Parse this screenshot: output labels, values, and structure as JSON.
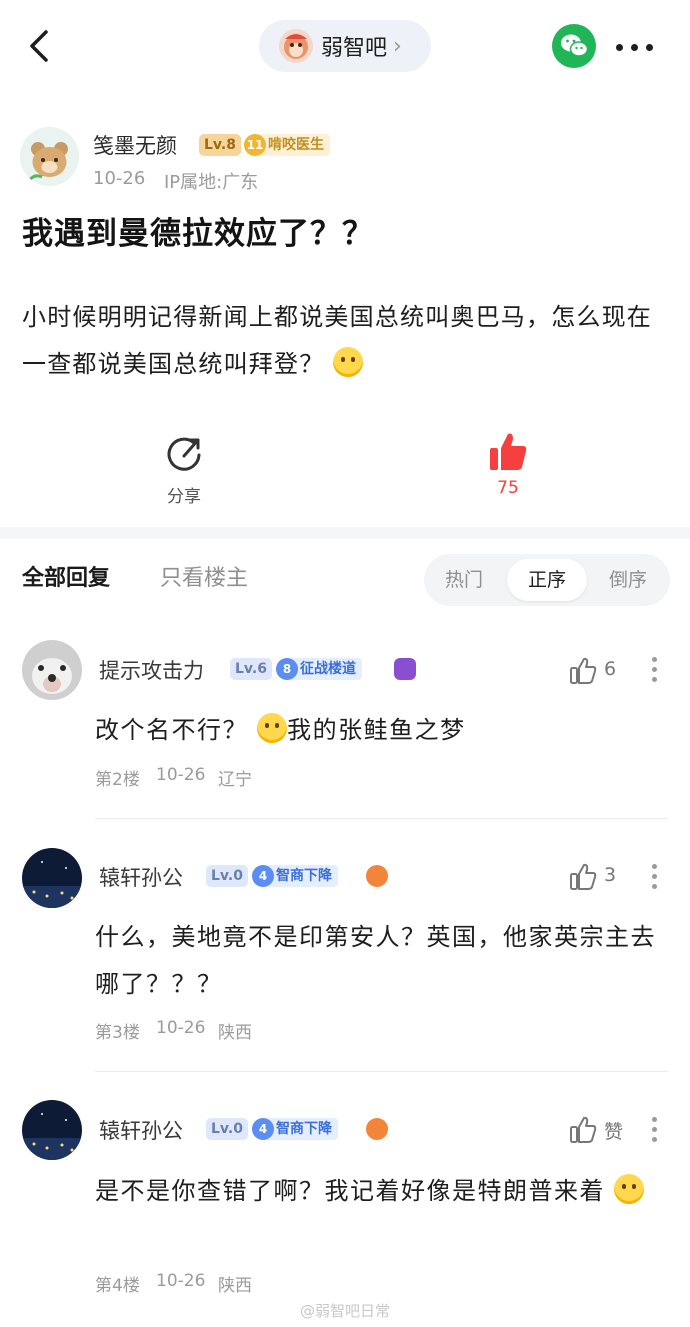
{
  "topbar": {
    "forum_name": "弱智吧",
    "chevron": "›"
  },
  "post": {
    "author": "笺墨无颜",
    "author_level": "Lv.8",
    "author_badge_num": "11",
    "author_badge": "啃咬医生",
    "date": "10-26",
    "ip": "IP属地:广东",
    "title": "我遇到曼德拉效应了？？",
    "body": "小时候明明记得新闻上都说美国总统叫奥巴马，怎么现在一查都说美国总统叫拜登？",
    "share_label": "分享",
    "like_count": "75"
  },
  "tabs": {
    "all": "全部回复",
    "owner_only": "只看楼主",
    "sort": [
      "热门",
      "正序",
      "倒序"
    ],
    "active_sort": "正序"
  },
  "comments": [
    {
      "name": "提示攻击力",
      "level": "Lv.6",
      "badge_num": "8",
      "badge": "征战楼道",
      "text_before": "改个名不行？",
      "text_after": "我的张鲑鱼之梦",
      "floor": "第2楼",
      "date": "10-26",
      "location": "辽宁",
      "likes": "6"
    },
    {
      "name": "辕轩孙公",
      "level": "Lv.0",
      "badge_num": "4",
      "badge": "智商下降",
      "text_before": "什么，美地竟不是印第安人？英国，他家英宗主去哪了？？？",
      "text_after": "",
      "floor": "第3楼",
      "date": "10-26",
      "location": "陕西",
      "likes": "3"
    },
    {
      "name": "辕轩孙公",
      "level": "Lv.0",
      "badge_num": "4",
      "badge": "智商下降",
      "text_before": "是不是你查错了啊？我记着好像是特朗普来着",
      "text_after": "",
      "floor": "第4楼",
      "date": "10-26",
      "location": "陕西",
      "likes": "赞"
    }
  ],
  "watermark": "@弱智吧日常",
  "colors": {
    "accent_red": "#f5403f",
    "wechat_green": "#20b557",
    "badge_blue": "#3c6fd9",
    "badge_gold": "#c38e1f"
  }
}
